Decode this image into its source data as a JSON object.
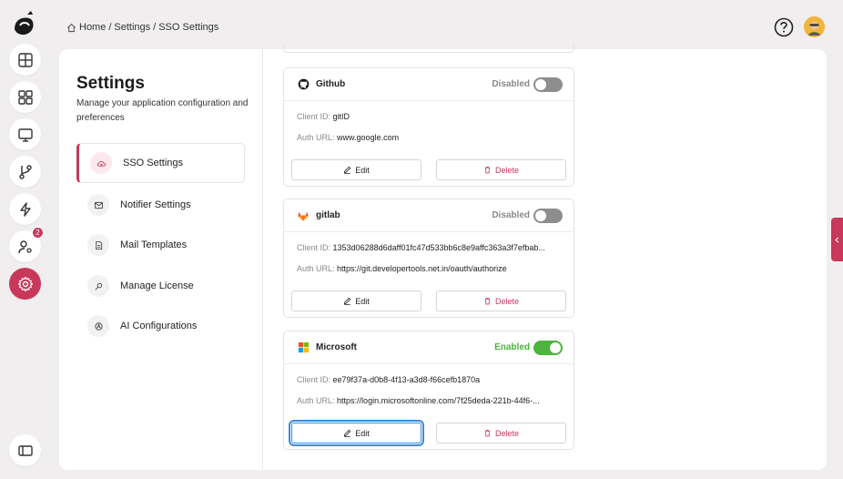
{
  "breadcrumb": {
    "home": "Home",
    "sep1": "/",
    "settings": "Settings",
    "sep2": "/",
    "current": "SSO Settings"
  },
  "rail": {
    "notification_badge": "2"
  },
  "settings": {
    "title": "Settings",
    "description": "Manage your application configuration and preferences",
    "menu": [
      {
        "label": "SSO Settings",
        "icon": "cloud-lock-icon"
      },
      {
        "label": "Notifier Settings",
        "icon": "mail-icon"
      },
      {
        "label": "Mail Templates",
        "icon": "document-icon"
      },
      {
        "label": "Manage License",
        "icon": "key-icon"
      },
      {
        "label": "AI Configurations",
        "icon": "ai-icon"
      }
    ]
  },
  "providers": [
    {
      "name": "Github",
      "status": "Disabled",
      "enabled": false,
      "client_id_label": "Client ID:",
      "client_id": "gitID",
      "auth_url_label": "Auth URL:",
      "auth_url": "www.google.com",
      "edit_label": "Edit",
      "delete_label": "Delete"
    },
    {
      "name": "gitlab",
      "status": "Disabled",
      "enabled": false,
      "client_id_label": "Client ID:",
      "client_id": "1353d06288d6daff01fc47d533bb6c8e9affc363a3f7efbab...",
      "auth_url_label": "Auth URL:",
      "auth_url": "https://git.developertools.net.in/oauth/authorize",
      "edit_label": "Edit",
      "delete_label": "Delete"
    },
    {
      "name": "Microsoft",
      "status": "Enabled",
      "enabled": true,
      "client_id_label": "Client ID:",
      "client_id": "ee79f37a-d0b8-4f13-a3d8-f66cefb1870a",
      "auth_url_label": "Auth URL:",
      "auth_url": "https://login.microsoftonline.com/7f25deda-221b-44f6-...",
      "edit_label": "Edit",
      "delete_label": "Delete"
    }
  ],
  "colors": {
    "accent": "#c7385a",
    "enabled": "#4cb33c",
    "disabled": "#8d8d8d",
    "focus": "#3a8bd6"
  }
}
